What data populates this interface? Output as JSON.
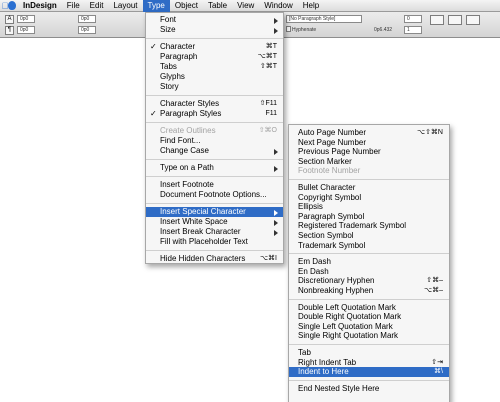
{
  "menubar": {
    "app_name": "InDesign",
    "items": [
      "File",
      "Edit",
      "Layout",
      "Type",
      "Object",
      "Table",
      "View",
      "Window",
      "Help"
    ],
    "active": "Type"
  },
  "control_palette": {
    "paragraph_style": "[No Paragraph Style]",
    "hyphenate": "Hyphenate",
    "field1": "0p0",
    "field2": "0p0",
    "field3": "0p0",
    "field4": "0p0",
    "value1": "0",
    "value2": "1",
    "grid_label": "0p6.432"
  },
  "type_menu": {
    "items": [
      {
        "label": "Font",
        "submenu": true
      },
      {
        "label": "Size",
        "submenu": true
      },
      {
        "sep": true
      },
      {
        "label": "Character",
        "check": true,
        "shortcut": "⌘T"
      },
      {
        "label": "Paragraph",
        "shortcut": "⌥⌘T"
      },
      {
        "label": "Tabs",
        "shortcut": "⇧⌘T"
      },
      {
        "label": "Glyphs"
      },
      {
        "label": "Story"
      },
      {
        "sep": true
      },
      {
        "label": "Character Styles",
        "shortcut": "⇧F11"
      },
      {
        "label": "Paragraph Styles",
        "check": true,
        "shortcut": "F11"
      },
      {
        "sep": true
      },
      {
        "label": "Create Outlines",
        "disabled": true,
        "shortcut": "⇧⌘O"
      },
      {
        "label": "Find Font..."
      },
      {
        "label": "Change Case",
        "submenu": true
      },
      {
        "sep": true
      },
      {
        "label": "Type on a Path",
        "submenu": true
      },
      {
        "sep": true
      },
      {
        "label": "Insert Footnote"
      },
      {
        "label": "Document Footnote Options..."
      },
      {
        "sep": true
      },
      {
        "label": "Insert Special Character",
        "submenu": true,
        "highlight": true
      },
      {
        "label": "Insert White Space",
        "submenu": true
      },
      {
        "label": "Insert Break Character",
        "submenu": true
      },
      {
        "label": "Fill with Placeholder Text"
      },
      {
        "sep": true
      },
      {
        "label": "Hide Hidden Characters",
        "shortcut": "⌥⌘I"
      }
    ]
  },
  "special_char_menu": {
    "items": [
      {
        "label": "Auto Page Number",
        "shortcut": "⌥⇧⌘N"
      },
      {
        "label": "Next Page Number"
      },
      {
        "label": "Previous Page Number"
      },
      {
        "label": "Section Marker"
      },
      {
        "label": "Footnote Number",
        "disabled": true
      },
      {
        "sep": true
      },
      {
        "label": "Bullet Character"
      },
      {
        "label": "Copyright Symbol"
      },
      {
        "label": "Ellipsis"
      },
      {
        "label": "Paragraph Symbol"
      },
      {
        "label": "Registered Trademark Symbol"
      },
      {
        "label": "Section Symbol"
      },
      {
        "label": "Trademark Symbol"
      },
      {
        "sep": true
      },
      {
        "label": "Em Dash"
      },
      {
        "label": "En Dash"
      },
      {
        "label": "Discretionary Hyphen",
        "shortcut": "⇧⌘–"
      },
      {
        "label": "Nonbreaking Hyphen",
        "shortcut": "⌥⌘–"
      },
      {
        "sep": true
      },
      {
        "label": "Double Left Quotation Mark"
      },
      {
        "label": "Double Right Quotation Mark"
      },
      {
        "label": "Single Left Quotation Mark"
      },
      {
        "label": "Single Right Quotation Mark"
      },
      {
        "sep": true
      },
      {
        "label": "Tab"
      },
      {
        "label": "Right Indent Tab",
        "shortcut": "⇧⇥"
      },
      {
        "label": "Indent to Here",
        "shortcut": "⌘\\",
        "highlight": true
      },
      {
        "sep": true
      },
      {
        "label": "End Nested Style Here"
      }
    ]
  },
  "colors": {
    "highlight": "#2f6cc6",
    "apple_logo": "#2a6fd1"
  }
}
